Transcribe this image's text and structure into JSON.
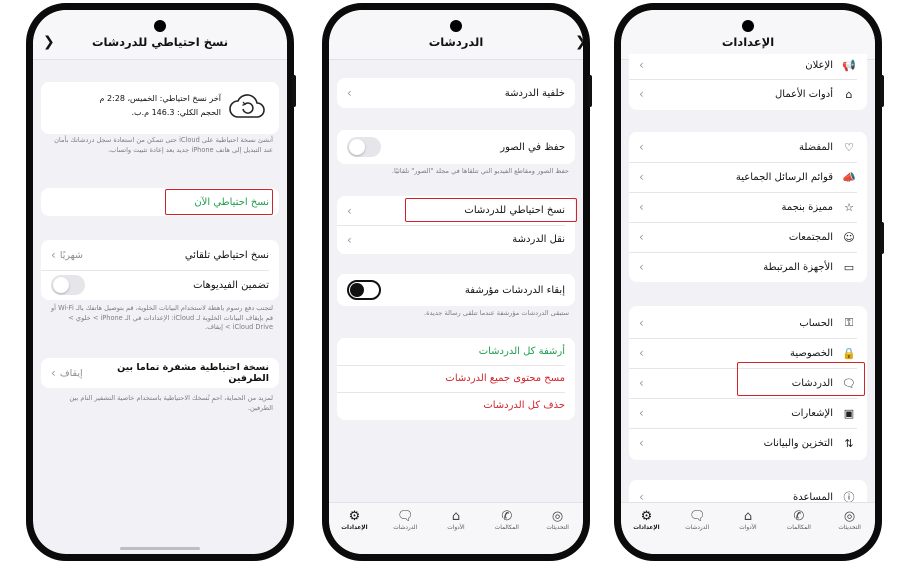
{
  "phone1": {
    "title": "نسخ احتياطي للدردشات",
    "backup_info": {
      "last_backup": "آخر نسخ احتياطي: الخميس، 2:28 م",
      "total_size": "الحجم الكلي: 146.3 م.ب."
    },
    "backup_description": "أنشئ نسخة احتياطية على iCloud حتى تتمكن من استعادة سجل دردشاتك بأمان عند التبديل إلى هاتف iPhone جديد بعد إعادة تثبيت واتساب.",
    "backup_now": "نسخ احتياطي الآن",
    "auto_backup": {
      "label": "نسخ احتياطي تلقائي",
      "value": "شهريًا"
    },
    "include_videos": "تضمين الفيديوهات",
    "cellular_note": "لتجنب دفع رسوم باهظة لاستخدام البيانات الخلوية، قم بتوصيل هاتفك بالـ Wi-Fi أو قم بإيقاف البيانات الخلوية لـ iCloud: الإعدادات في الـ iPhone > خلوي > iCloud Drive > إيقاف.",
    "e2e_backup": {
      "label": "نسخة احتياطية مشفرة تماما بين الطرفين",
      "value": "إيقاف"
    },
    "e2e_note": "لمزيد من الحماية، احمِ نُسخك الاحتياطية باستخدام خاصية التشفير التام بين الطرفين."
  },
  "phone2": {
    "title": "الدردشات",
    "wallpaper": "خلفية الدردشة",
    "save_to_photos": "حفظ في الصور",
    "save_note": "حفظ الصور ومقاطع الفيديو التي تتلقاها في مجلد \"الصور\" تلقائيًا.",
    "chat_backup": "نسخ احتياطي للدردشات",
    "move_chats": "نقل الدردشة",
    "keep_archived": "إبقاء الدردشات مؤرشفة",
    "archived_note": "ستبقى الدردشات مؤرشفة عندما تتلقى رسالة جديدة.",
    "archive_all": "أرشفة كل الدردشات",
    "clear_all": "مسح محتوى جميع الدردشات",
    "delete_all": "حذف كل الدردشات"
  },
  "phone3": {
    "title": "الإعدادات",
    "group_a": [
      "الإعلان",
      "أدوات الأعمال"
    ],
    "group_b": [
      "المفضلة",
      "قوائم الرسائل الجماعية",
      "مميزة بنجمة",
      "المجتمعات",
      "الأجهزة المرتبطة"
    ],
    "group_c": [
      "الحساب",
      "الخصوصية",
      "الدردشات",
      "الإشعارات",
      "التخزين والبيانات"
    ],
    "group_d": [
      "المساعدة"
    ]
  },
  "tabs": {
    "updates": "التحديثات",
    "calls": "المكالمات",
    "tools": "الأدوات",
    "chats": "الدردشات",
    "settings": "الإعدادات"
  },
  "colors": {
    "accent_green": "#1e9f4e",
    "danger_red": "#d2232a",
    "highlight_box": "#d2232a"
  }
}
